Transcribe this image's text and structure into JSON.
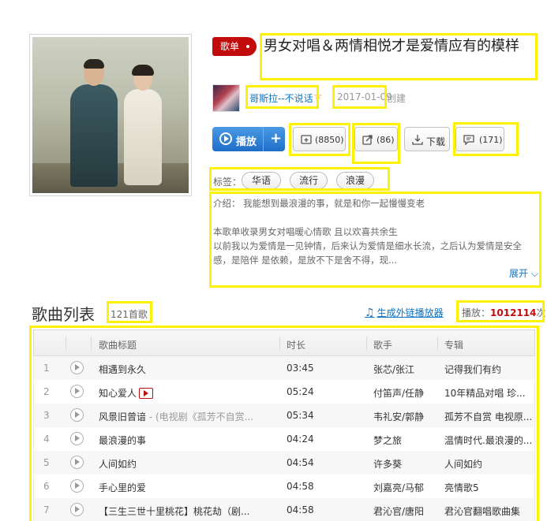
{
  "playlist": {
    "badge": "歌单",
    "title": "男女对唱＆两情相悦才是爱情应有的模样",
    "creator": "哥斯拉--不说话",
    "date": "2017-01-09",
    "created_label": "创建"
  },
  "actions": {
    "play_label": "播放",
    "plus_label": "+",
    "collect_count": "(8850)",
    "share_count": "(86)",
    "download_label": "下载",
    "comment_count": "(171)"
  },
  "tags": {
    "label": "标签：",
    "items": [
      "华语",
      "流行",
      "浪漫"
    ]
  },
  "intro": {
    "lines": [
      "介绍： 我能想到最浪漫的事，就是和你一起慢慢变老",
      "",
      "本歌单收录男女对唱暖心情歌 且以欢喜共余生",
      "以前我以为爱情是一见钟情，后来认为爱情是细水长流，之后认为爱情是安全",
      "感，是陪伴 是依赖，是放不下是舍不得，现..."
    ],
    "expand": "展开"
  },
  "songlist": {
    "title": "歌曲列表",
    "count": "121首歌",
    "gen_link": "生成外链播放器",
    "plays_prefix": "播放：",
    "plays_value": "1012114",
    "plays_suffix": "次",
    "headers": {
      "title": "歌曲标题",
      "duration": "时长",
      "singer": "歌手",
      "album": "专辑"
    },
    "rows": [
      {
        "num": "1",
        "title": "相遇到永久",
        "sub": "",
        "mv": false,
        "duration": "03:45",
        "singer": "张芯/张江",
        "album": "记得我们有约"
      },
      {
        "num": "2",
        "title": "知心爱人",
        "sub": "",
        "mv": true,
        "duration": "05:24",
        "singer": "付笛声/任静",
        "album": "10年精品对唱 珍..."
      },
      {
        "num": "3",
        "title": "风景旧曾谙",
        "sub": " - (电视剧《孤芳不自赏...",
        "mv": false,
        "duration": "05:34",
        "singer": "韦礼安/郭静",
        "album": "孤芳不自赏 电视原..."
      },
      {
        "num": "4",
        "title": "最浪漫的事",
        "sub": "",
        "mv": false,
        "duration": "04:24",
        "singer": "梦之旅",
        "album": "温情时代.最浪漫的..."
      },
      {
        "num": "5",
        "title": "人间如约",
        "sub": "",
        "mv": false,
        "duration": "04:54",
        "singer": "许多葵",
        "album": "人间如约"
      },
      {
        "num": "6",
        "title": "手心里的爱",
        "sub": "",
        "mv": false,
        "duration": "04:58",
        "singer": "刘嘉亮/马郁",
        "album": "亮情歌5"
      },
      {
        "num": "7",
        "title": "【三生三世十里桃花】桃花劫（剧...",
        "sub": "",
        "mv": false,
        "duration": "04:58",
        "singer": "君沁官/唐阳",
        "album": "君沁官翻唱歌曲集"
      }
    ]
  },
  "colors": {
    "accent": "#c20c0c",
    "link": "#0c73c2",
    "highlight": "#fff200"
  }
}
